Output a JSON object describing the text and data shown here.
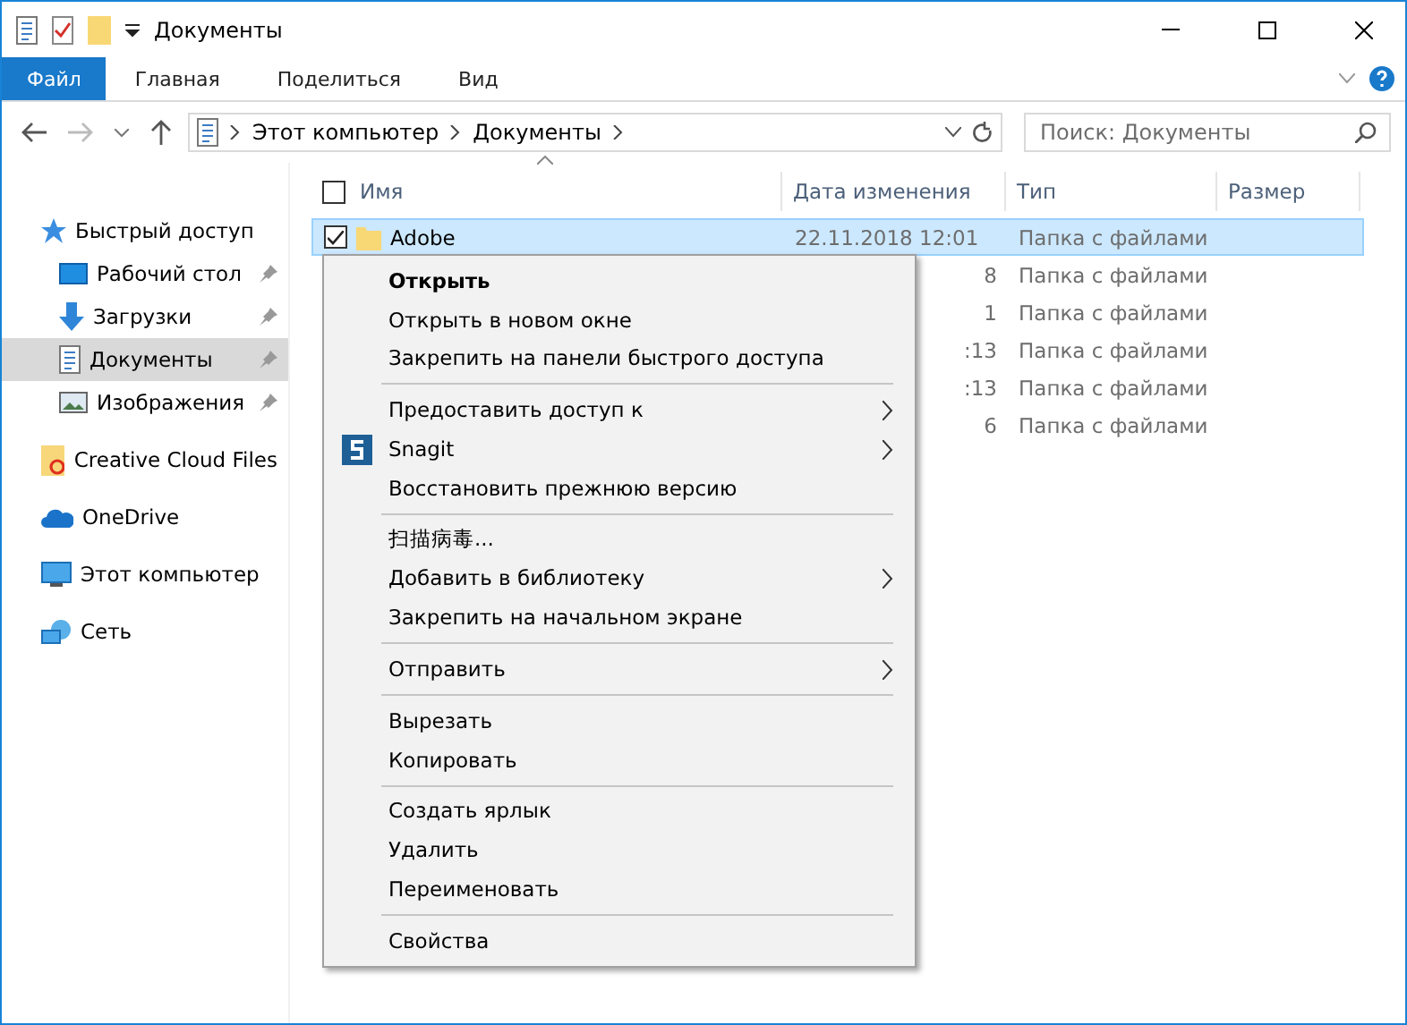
{
  "window": {
    "title": "Документы"
  },
  "ribbon_tabs": [
    {
      "label": "Файл",
      "selected": true
    },
    {
      "label": "Главная",
      "selected": false
    },
    {
      "label": "Поделиться",
      "selected": false
    },
    {
      "label": "Вид",
      "selected": false
    }
  ],
  "address": {
    "path": [
      "Этот компьютер",
      "Документы"
    ]
  },
  "search": {
    "placeholder": "Поиск: Документы"
  },
  "sidebar": {
    "items": [
      {
        "label": "Быстрый доступ",
        "kind": "star",
        "selected": false,
        "children": [
          {
            "label": "Рабочий стол",
            "kind": "desktop",
            "selected": false
          },
          {
            "label": "Загрузки",
            "kind": "download",
            "selected": false
          },
          {
            "label": "Документы",
            "kind": "document",
            "selected": true
          },
          {
            "label": "Изображения",
            "kind": "image",
            "selected": false
          }
        ]
      },
      {
        "label": "Creative Cloud Files",
        "kind": "cloudfiles",
        "selected": false
      },
      {
        "label": "OneDrive",
        "kind": "onedrive",
        "selected": false
      },
      {
        "label": "Этот компьютер",
        "kind": "computer",
        "selected": false
      },
      {
        "label": "Сеть",
        "kind": "network",
        "selected": false
      }
    ]
  },
  "table": {
    "select_all": {
      "checked": false
    },
    "columns": [
      "Имя",
      "Дата изменения",
      "Тип",
      "Размер"
    ],
    "rows": [
      {
        "name": "Adobe",
        "date": "22.11.2018 12:01",
        "type": "Папка с файлами",
        "selected": true,
        "checked": true
      },
      {
        "name": "",
        "date": "8",
        "type": "Папка с файлами",
        "selected": false
      },
      {
        "name": "",
        "date": "1",
        "type": "Папка с файлами",
        "selected": false
      },
      {
        "name": "",
        "date": ":13",
        "type": "Папка с файлами",
        "selected": false
      },
      {
        "name": "",
        "date": ":13",
        "type": "Папка с файлами",
        "selected": false
      },
      {
        "name": "",
        "date": "6",
        "type": "Папка с файлами",
        "selected": false
      }
    ]
  },
  "context_menu": {
    "groups": [
      [
        {
          "label": "Открыть",
          "bold": true,
          "submenu": false
        },
        {
          "label": "Открыть в новом окне",
          "bold": false,
          "submenu": false
        },
        {
          "label": "Закрепить на панели быстрого доступа",
          "bold": false,
          "submenu": false
        }
      ],
      [
        {
          "label": "Предоставить доступ к",
          "bold": false,
          "submenu": true
        },
        {
          "label": "Snagit",
          "bold": false,
          "submenu": true,
          "kind": "snagit"
        },
        {
          "label": "Восстановить прежнюю версию",
          "bold": false,
          "submenu": false
        }
      ],
      [
        {
          "label": "扫描病毒...",
          "bold": false,
          "submenu": false
        },
        {
          "label": "Добавить в библиотеку",
          "bold": false,
          "submenu": true
        },
        {
          "label": "Закрепить на начальном экране",
          "bold": false,
          "submenu": false
        }
      ],
      [
        {
          "label": "Отправить",
          "bold": false,
          "submenu": true
        }
      ],
      [
        {
          "label": "Вырезать",
          "bold": false,
          "submenu": false
        },
        {
          "label": "Копировать",
          "bold": false,
          "submenu": false
        }
      ],
      [
        {
          "label": "Создать ярлык",
          "bold": false,
          "submenu": false
        },
        {
          "label": "Удалить",
          "bold": false,
          "submenu": false
        },
        {
          "label": "Переименовать",
          "bold": false,
          "submenu": false
        }
      ],
      [
        {
          "label": "Свойства",
          "bold": false,
          "submenu": false
        }
      ]
    ]
  }
}
